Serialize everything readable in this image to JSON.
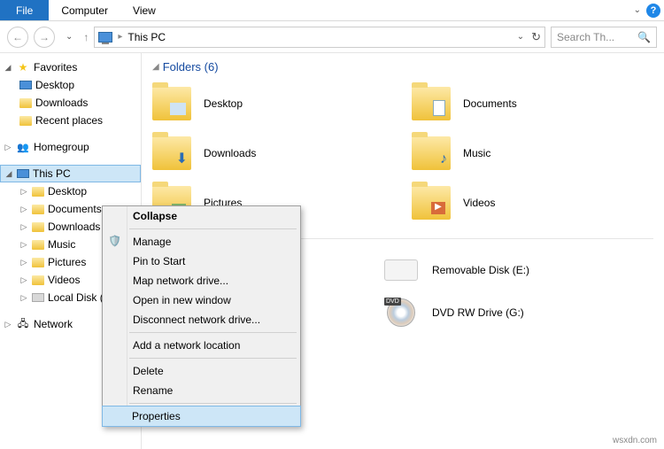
{
  "ribbon": {
    "file": "File",
    "tabs": [
      "Computer",
      "View"
    ]
  },
  "address": {
    "location": "This PC"
  },
  "search": {
    "placeholder": "Search Th..."
  },
  "tree": {
    "favorites": {
      "label": "Favorites",
      "items": [
        "Desktop",
        "Downloads",
        "Recent places"
      ]
    },
    "homegroup": {
      "label": "Homegroup"
    },
    "thispc": {
      "label": "This PC",
      "items": [
        "Desktop",
        "Documents",
        "Downloads",
        "Music",
        "Pictures",
        "Videos",
        "Local Disk (..."
      ]
    },
    "network": {
      "label": "Network"
    }
  },
  "content": {
    "folders_header": "Folders (6)",
    "folders": [
      {
        "name": "Desktop",
        "overlay": ""
      },
      {
        "name": "Documents",
        "overlay": ""
      },
      {
        "name": "Downloads",
        "overlay": "⬇"
      },
      {
        "name": "Music",
        "overlay": "♪"
      },
      {
        "name": "Pictures",
        "overlay": ""
      },
      {
        "name": "Videos",
        "overlay": "▶"
      }
    ],
    "devices": [
      {
        "name": "Removable Disk (E:)",
        "type": "removable"
      },
      {
        "name": "DVD RW Drive (G:)",
        "type": "dvd"
      }
    ]
  },
  "context_menu": {
    "items": [
      {
        "label": "Collapse",
        "bold": true
      },
      {
        "label": "Manage",
        "shield": true
      },
      {
        "label": "Pin to Start"
      },
      {
        "label": "Map network drive..."
      },
      {
        "label": "Open in new window"
      },
      {
        "label": "Disconnect network drive..."
      },
      {
        "sep": true
      },
      {
        "label": "Add a network location"
      },
      {
        "sep": true
      },
      {
        "label": "Delete"
      },
      {
        "label": "Rename"
      },
      {
        "sep": true
      },
      {
        "label": "Properties",
        "hover": true
      }
    ]
  },
  "watermark": "wsxdn.com"
}
